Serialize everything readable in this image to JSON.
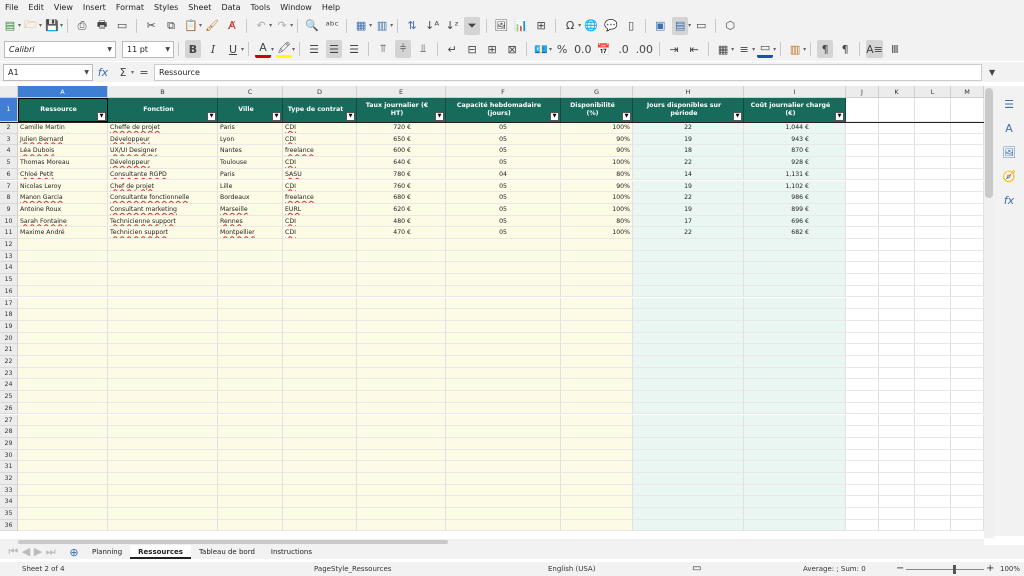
{
  "menu": [
    "File",
    "Edit",
    "View",
    "Insert",
    "Format",
    "Styles",
    "Sheet",
    "Data",
    "Tools",
    "Window",
    "Help"
  ],
  "font": {
    "name": "Calibri",
    "size": "11 pt"
  },
  "namebox": "A1",
  "formula": {
    "fx": "fx",
    "sum": "Σ",
    "eq": "=",
    "content": "Ressource"
  },
  "columns": [
    "A",
    "B",
    "C",
    "D",
    "E",
    "F",
    "G",
    "H",
    "I",
    "J",
    "K",
    "L",
    "M"
  ],
  "headers": [
    "Ressource",
    "Fonction",
    "Ville",
    "Type de contrat",
    "Taux journalier (€ HT)",
    "Capacité hebdomadaire (jours)",
    "Disponibilité (%)",
    "Jours disponibles sur période",
    "Coût journalier chargé (€)"
  ],
  "rows": [
    [
      "Camille Martin",
      "Cheffe de projet",
      "Paris",
      "CDI",
      "720 €",
      "05",
      "100%",
      "22",
      "1,044 €"
    ],
    [
      "Julien Bernard",
      "Développeur",
      "Lyon",
      "CDI",
      "650 €",
      "05",
      "90%",
      "19",
      "943 €"
    ],
    [
      "Léa Dubois",
      "UX/UI Designer",
      "Nantes",
      "freelance",
      "600 €",
      "05",
      "90%",
      "18",
      "870 €"
    ],
    [
      "Thomas Moreau",
      "Développeur",
      "Toulouse",
      "CDI",
      "640 €",
      "05",
      "100%",
      "22",
      "928 €"
    ],
    [
      "Chloé Petit",
      "Consultante RGPD",
      "Paris",
      "SASU",
      "780 €",
      "04",
      "80%",
      "14",
      "1,131 €"
    ],
    [
      "Nicolas Leroy",
      "Chef de projet",
      "Lille",
      "CDI",
      "760 €",
      "05",
      "90%",
      "19",
      "1,102 €"
    ],
    [
      "Manon Garcia",
      "Consultante fonctionnelle",
      "Bordeaux",
      "freelance",
      "680 €",
      "05",
      "100%",
      "22",
      "986 €"
    ],
    [
      "Antoine Roux",
      "Consultant marketing",
      "Marseille",
      "EURL",
      "620 €",
      "05",
      "100%",
      "19",
      "899 €"
    ],
    [
      "Sarah Fontaine",
      "Technicienne support",
      "Rennes",
      "CDI",
      "480 €",
      "05",
      "80%",
      "17",
      "696 €"
    ],
    [
      "Maxime André",
      "Technicien support",
      "Montpellier",
      "CDI",
      "470 €",
      "05",
      "100%",
      "22",
      "682 €"
    ]
  ],
  "row_numbers": [
    "1",
    "2",
    "3",
    "4",
    "5",
    "6",
    "7",
    "8",
    "9",
    "10",
    "11",
    "12",
    "13",
    "14",
    "15",
    "16",
    "17",
    "18",
    "19",
    "20",
    "21",
    "22",
    "23",
    "24",
    "25",
    "26",
    "27",
    "28",
    "29",
    "30",
    "31",
    "32",
    "33",
    "34",
    "35",
    "36"
  ],
  "tabs": [
    "Planning",
    "Ressources",
    "Tableau de bord",
    "Instructions"
  ],
  "active_tab": "Ressources",
  "status": {
    "sheet": "Sheet 2 of 4",
    "pagestyle": "PageStyle_Ressources",
    "lang": "English (USA)",
    "calc": "Average: ; Sum: 0",
    "zoom": "100%"
  },
  "colors": {
    "header_bg": "#176b5b",
    "cream": "#fdfbe6",
    "mint": "#eaf6f1",
    "selection": "#3e7fd4"
  }
}
